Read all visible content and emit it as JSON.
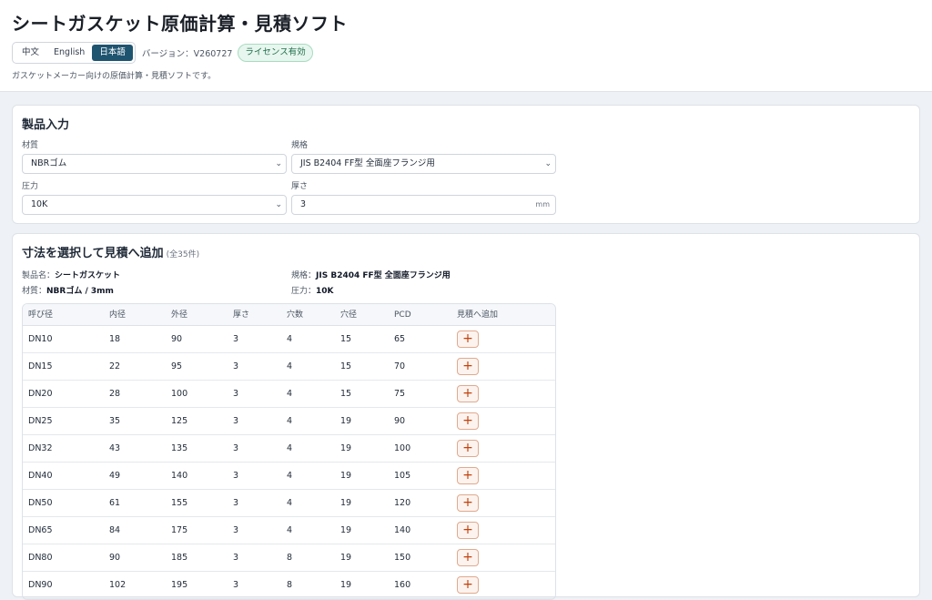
{
  "app": {
    "title": "シートガスケット原価計算・見積ソフト",
    "languages": [
      "中文",
      "English",
      "日本語"
    ],
    "active_language": "日本語",
    "version": "バージョン：V260727",
    "license_badge": "ライセンス有効",
    "description": "ガスケットメーカー向けの原価計算・見積ソフトです。"
  },
  "product_input": {
    "title": "製品入力",
    "material_label": "材質",
    "material_value": "NBRゴム",
    "standard_label": "規格",
    "standard_value": "JIS B2404 FF型 全面座フランジ用",
    "pressure_label": "圧力",
    "pressure_value": "10K",
    "thickness_label": "厚さ",
    "thickness_value": "3",
    "thickness_unit": "mm"
  },
  "size_select": {
    "title": "寸法を選択して見積へ追加",
    "count": "(全35件)",
    "product_name_label": "製品名：",
    "product_name": "シートガスケット",
    "standard_label": "規格：",
    "standard": "JIS B2404 FF型 全面座フランジ用",
    "material_label": "材質：",
    "material": "NBRゴム / 3mm",
    "pressure_label": "圧力：",
    "pressure": "10K"
  },
  "table": {
    "columns": [
      "呼び径",
      "内径",
      "外径",
      "厚さ",
      "穴数",
      "穴径",
      "PCD",
      "見積へ追加"
    ],
    "add_symbol": "+",
    "rows": [
      [
        "DN10",
        "18",
        "90",
        "3",
        "4",
        "15",
        "65"
      ],
      [
        "DN15",
        "22",
        "95",
        "3",
        "4",
        "15",
        "70"
      ],
      [
        "DN20",
        "28",
        "100",
        "3",
        "4",
        "15",
        "75"
      ],
      [
        "DN25",
        "35",
        "125",
        "3",
        "4",
        "19",
        "90"
      ],
      [
        "DN32",
        "43",
        "135",
        "3",
        "4",
        "19",
        "100"
      ],
      [
        "DN40",
        "49",
        "140",
        "3",
        "4",
        "19",
        "105"
      ],
      [
        "DN50",
        "61",
        "155",
        "3",
        "4",
        "19",
        "120"
      ],
      [
        "DN65",
        "84",
        "175",
        "3",
        "4",
        "19",
        "140"
      ],
      [
        "DN80",
        "90",
        "185",
        "3",
        "8",
        "19",
        "150"
      ],
      [
        "DN90",
        "102",
        "195",
        "3",
        "8",
        "19",
        "160"
      ]
    ]
  }
}
